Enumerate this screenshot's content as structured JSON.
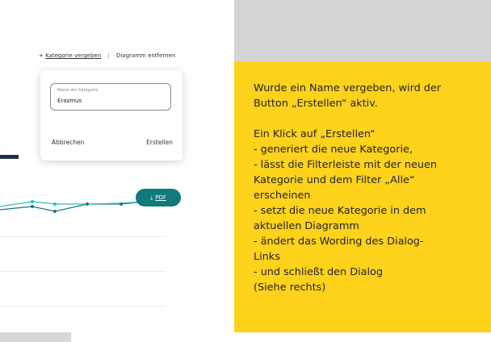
{
  "app": {
    "toolbar": {
      "plus": "+",
      "assign_category_link": "Kategorie vergeben",
      "separator": "|",
      "remove_chart_link": "Diagramm entfernen"
    },
    "dialog": {
      "name_field_label": "Name der Kategorie",
      "name_field_value": "Erasmus",
      "cancel_label": "Abbrechen",
      "create_label": "Erstellen"
    },
    "pdf_button": {
      "icon": "download-icon",
      "label": "PDF"
    },
    "colors": {
      "teal": "#127a7a",
      "line_light": "#2bbfae",
      "line_dark": "#1e6f8f",
      "navy": "#1f2f45"
    }
  },
  "note": {
    "lines": [
      "Wurde ein Name vergeben, wird der",
      "Button „Erstellen“ aktiv.",
      "Ein Klick auf „Erstellen“",
      "- generiert die neue Kategorie,",
      "- lässt die Filterleiste mit der neuen",
      "Kategorie und dem Filter „Alle“",
      "erscheinen",
      "- setzt die neue Kategorie in dem",
      "aktuellen Diagramm",
      "- ändert das Wording des Dialog-",
      "Links",
      "- und schließt den Dialog",
      "(Siehe rechts)"
    ],
    "background": "#ffd21b"
  }
}
